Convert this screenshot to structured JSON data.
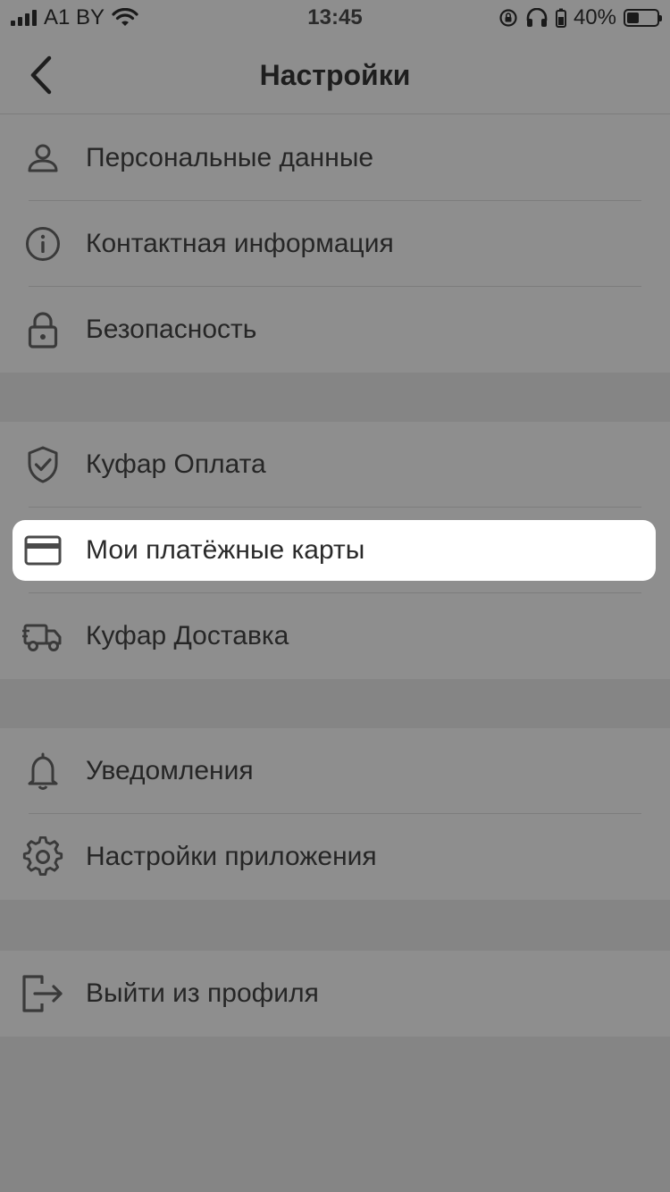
{
  "status_bar": {
    "carrier": "A1 BY",
    "time": "13:45",
    "battery_percent": "40%",
    "battery_level": 0.4
  },
  "nav": {
    "title": "Настройки",
    "back_icon": "chevron-left-icon"
  },
  "groups": [
    {
      "items": [
        {
          "label": "Персональные данные",
          "icon": "person-icon"
        },
        {
          "label": "Контактная информация",
          "icon": "info-icon"
        },
        {
          "label": "Безопасность",
          "icon": "lock-icon"
        }
      ]
    },
    {
      "items": [
        {
          "label": "Куфар Оплата",
          "icon": "shield-check-icon"
        },
        {
          "label": "Мои платёжные карты",
          "icon": "credit-card-icon",
          "highlighted": true
        },
        {
          "label": "Куфар Доставка",
          "icon": "delivery-truck-icon"
        }
      ]
    },
    {
      "items": [
        {
          "label": "Уведомления",
          "icon": "bell-icon"
        },
        {
          "label": "Настройки приложения",
          "icon": "gear-icon"
        }
      ]
    },
    {
      "items": [
        {
          "label": "Выйти из профиля",
          "icon": "logout-icon"
        }
      ]
    }
  ],
  "colors": {
    "overlay_bg": "#8e8e8e",
    "highlight_bg": "#ffffff",
    "text": "#262626",
    "icon": "#3a3a3a"
  }
}
